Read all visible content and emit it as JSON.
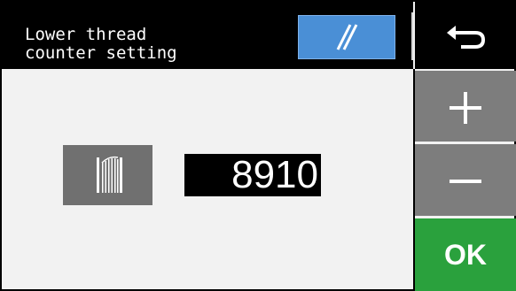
{
  "screen": {
    "title": "Lower thread\ncounter setting"
  },
  "header": {
    "reset_icon": "diagonal-slash-icon",
    "back_icon": "return-arrow-icon"
  },
  "main": {
    "bobbin_icon": "bobbin-spool-icon",
    "counter_value": "8910"
  },
  "side": {
    "plus_icon": "plus-icon",
    "minus_icon": "minus-icon",
    "ok_label": "OK"
  },
  "colors": {
    "header_bg": "#000000",
    "reset_button": "#4a8fd6",
    "side_button": "#7d7d7d",
    "ok_button": "#2aa13d",
    "content_bg": "#f2f2f2"
  }
}
